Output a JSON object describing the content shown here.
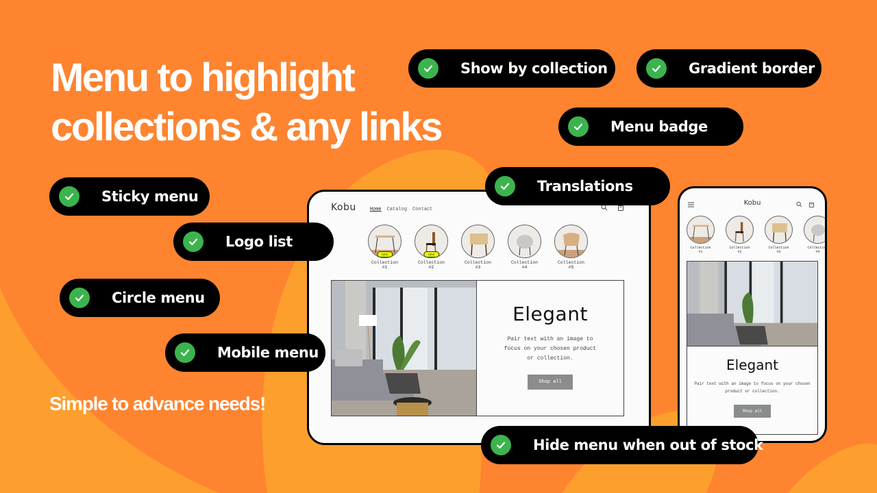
{
  "headline": {
    "line1": "Menu to highlight",
    "line2": "collections & any links"
  },
  "tagline": "Simple to advance needs!",
  "features": [
    {
      "label": "Show by collection",
      "icon": "check-icon"
    },
    {
      "label": "Gradient border",
      "icon": "check-icon"
    },
    {
      "label": "Menu badge",
      "icon": "check-icon"
    },
    {
      "label": "Translations",
      "icon": "check-icon"
    },
    {
      "label": "Sticky menu",
      "icon": "check-icon"
    },
    {
      "label": "Logo list",
      "icon": "check-icon"
    },
    {
      "label": "Circle menu",
      "icon": "check-icon"
    },
    {
      "label": "Mobile menu",
      "icon": "check-icon"
    },
    {
      "label": "Hide menu when out of stock",
      "icon": "check-icon"
    }
  ],
  "desktop": {
    "logo": "Kobu",
    "nav": [
      {
        "label": "Home",
        "active": true
      },
      {
        "label": "Catalog",
        "active": false
      },
      {
        "label": "Contact",
        "active": false
      }
    ],
    "collections": [
      {
        "name": "Collection",
        "num": "#1",
        "badge": "NEW"
      },
      {
        "name": "Collection",
        "num": "#2",
        "badge": "NEW"
      },
      {
        "name": "Collection",
        "num": "#3",
        "badge": null
      },
      {
        "name": "Collection",
        "num": "#4",
        "badge": null
      },
      {
        "name": "Collection",
        "num": "#5",
        "badge": null
      }
    ],
    "hero": {
      "title": "Elegant",
      "body": "Pair text with an image to focus on your chosen product or collection.",
      "button": "Shop all"
    }
  },
  "mobile": {
    "logo": "Kobu",
    "collections": [
      {
        "name": "Collection",
        "num": "#1"
      },
      {
        "name": "Collection",
        "num": "#2"
      },
      {
        "name": "Collection",
        "num": "#3"
      },
      {
        "name": "Collection",
        "num": "#4"
      }
    ],
    "hero": {
      "title": "Elegant",
      "body": "Pair text with an image to focus on your chosen product or collection.",
      "button": "Shop all"
    }
  },
  "colors": {
    "background": "#fe8430",
    "background_shape": "#fda22e",
    "pill": "#000000",
    "check": "#3cb44e",
    "badge": "#e8f500"
  }
}
